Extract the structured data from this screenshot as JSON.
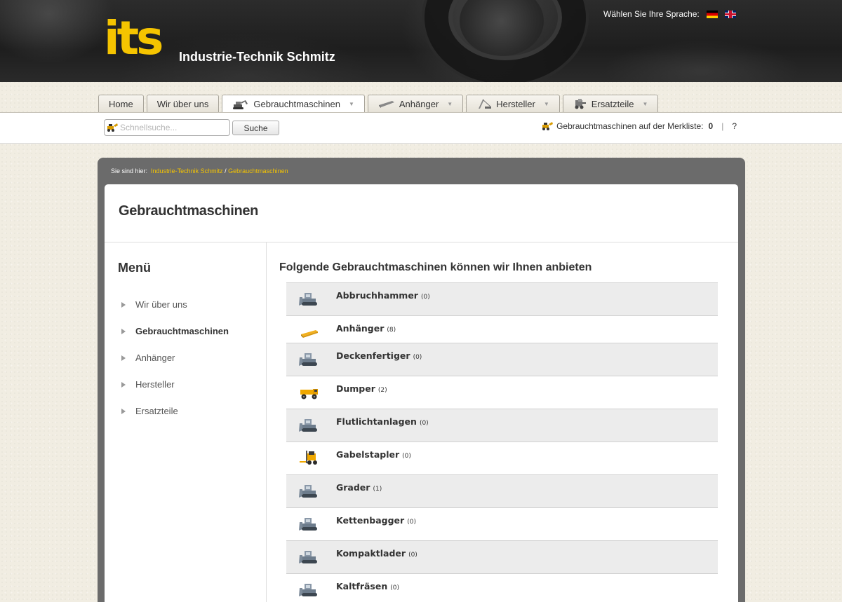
{
  "header": {
    "logo_text": "its",
    "company_name": "Industrie-Technik Schmitz",
    "language_prompt": "Wählen Sie Ihre Sprache:",
    "languages": [
      "Deutsch",
      "English"
    ]
  },
  "nav": {
    "tabs": [
      {
        "label": "Home",
        "icon": "",
        "dropdown": false,
        "active": false
      },
      {
        "label": "Wir über uns",
        "icon": "",
        "dropdown": false,
        "active": false
      },
      {
        "label": "Gebrauchtmaschinen",
        "icon": "excavator-icon",
        "dropdown": true,
        "active": true
      },
      {
        "label": "Anhänger",
        "icon": "trailer-icon",
        "dropdown": true,
        "active": false
      },
      {
        "label": "Hersteller",
        "icon": "crane-icon",
        "dropdown": true,
        "active": false
      },
      {
        "label": "Ersatzteile",
        "icon": "parts-icon",
        "dropdown": true,
        "active": false
      }
    ]
  },
  "search": {
    "placeholder": "Schnellsuche...",
    "value": "",
    "button_label": "Suche"
  },
  "watchlist": {
    "label": "Gebrauchtmaschinen auf der Merkliste:",
    "count": "0",
    "help": "?"
  },
  "breadcrumb": {
    "prefix": "Sie sind hier:",
    "home": "Industrie-Technik Schmitz",
    "separator": "/",
    "current": "Gebrauchtmaschinen"
  },
  "page": {
    "title": "Gebrauchtmaschinen"
  },
  "sidebar": {
    "title": "Menü",
    "items": [
      {
        "label": "Wir über uns",
        "active": false
      },
      {
        "label": "Gebrauchtmaschinen",
        "active": true
      },
      {
        "label": "Anhänger",
        "active": false
      },
      {
        "label": "Hersteller",
        "active": false
      },
      {
        "label": "Ersatzteile",
        "active": false
      }
    ]
  },
  "main": {
    "heading": "Folgende Gebrauchtmaschinen können wir Ihnen anbieten",
    "categories": [
      {
        "name": "Abbruchhammer",
        "count": "(0)",
        "icon": "bulldozer-icon"
      },
      {
        "name": "Anhänger",
        "count": "(8)",
        "icon": "trailer-icon"
      },
      {
        "name": "Deckenfertiger",
        "count": "(0)",
        "icon": "bulldozer-icon"
      },
      {
        "name": "Dumper",
        "count": "(2)",
        "icon": "dumper-icon"
      },
      {
        "name": "Flutlichtanlagen",
        "count": "(0)",
        "icon": "bulldozer-icon"
      },
      {
        "name": "Gabelstapler",
        "count": "(0)",
        "icon": "forklift-icon"
      },
      {
        "name": "Grader",
        "count": "(1)",
        "icon": "bulldozer-icon"
      },
      {
        "name": "Kettenbagger",
        "count": "(0)",
        "icon": "bulldozer-icon"
      },
      {
        "name": "Kompaktlader",
        "count": "(0)",
        "icon": "bulldozer-icon"
      },
      {
        "name": "Kaltfräsen",
        "count": "(0)",
        "icon": "bulldozer-icon"
      }
    ]
  },
  "colors": {
    "brand_yellow": "#f5c400",
    "frame_gray": "#6b6b6b",
    "row_shade": "#ececec",
    "page_bg": "#f1ede2"
  }
}
